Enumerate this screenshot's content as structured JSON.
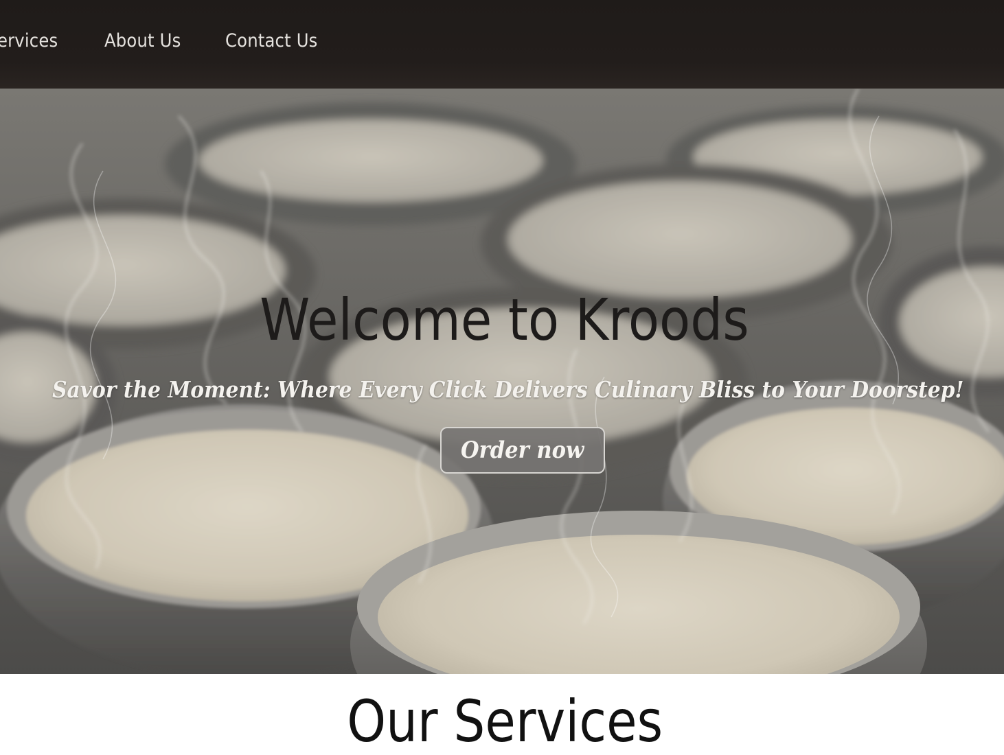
{
  "nav": {
    "items": [
      {
        "label": "ervices"
      },
      {
        "label": "About Us"
      },
      {
        "label": "Contact Us"
      }
    ]
  },
  "hero": {
    "title": "Welcome to Kroods",
    "tagline": "Savor the Moment: Where Every Click Delivers Culinary Bliss to Your Doorstep!",
    "cta_label": "Order now"
  },
  "services": {
    "title": "Our Services"
  },
  "colors": {
    "nav_background": "#221d1b",
    "nav_text": "#e6e3df",
    "hero_title": "#1d1b1a",
    "tagline": "#f4f2ee",
    "button_background": "#767472",
    "page_background": "#ffffff"
  }
}
